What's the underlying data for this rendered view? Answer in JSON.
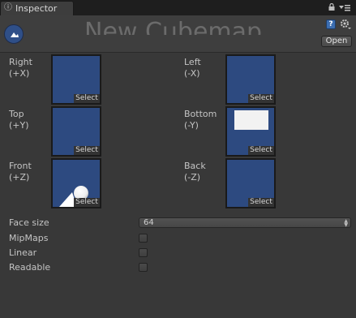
{
  "window": {
    "tab_label": "Inspector",
    "tab_icon": "info-icon"
  },
  "header": {
    "title": "New Cubemap",
    "open_label": "Open",
    "asset_icon": "cubemap-icon",
    "help_icon": "help-icon",
    "gear_icon": "gear-icon"
  },
  "faces": [
    {
      "label": "Right",
      "axis": "(+X)",
      "select_label": "Select"
    },
    {
      "label": "Left",
      "axis": "(-X)",
      "select_label": "Select"
    },
    {
      "label": "Top",
      "axis": "(+Y)",
      "select_label": "Select"
    },
    {
      "label": "Bottom",
      "axis": "(-Y)",
      "select_label": "Select"
    },
    {
      "label": "Front",
      "axis": "(+Z)",
      "select_label": "Select"
    },
    {
      "label": "Back",
      "axis": "(-Z)",
      "select_label": "Select"
    }
  ],
  "properties": {
    "face_size": {
      "label": "Face size",
      "value": "64"
    },
    "mipmaps": {
      "label": "MipMaps",
      "checked": false
    },
    "linear": {
      "label": "Linear",
      "checked": false
    },
    "readable": {
      "label": "Readable",
      "checked": false
    }
  },
  "colors": {
    "face_bg": "#2d4a80",
    "panel_bg": "#383838"
  }
}
